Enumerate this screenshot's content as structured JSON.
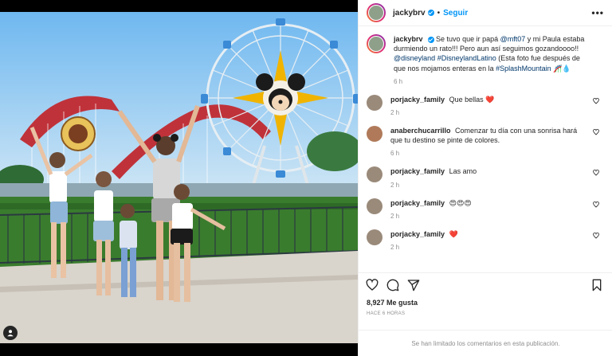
{
  "header": {
    "username": "jackybrv",
    "separator": "•",
    "follow_label": "Seguir",
    "more_label": "•••"
  },
  "caption": {
    "username": "jackybrv",
    "text_a": "Se tuvo que ir papá",
    "mention_1": "@mft07",
    "text_b": "y mi Paula estaba durmiendo un rato!!! Pero aun así seguimos gozandoooo!!",
    "mention_2": "@disneyland",
    "hashtag_1": "#DisneylandLatino",
    "text_c": "(Esta foto fue después de que nos mojamos enteras en la",
    "hashtag_2": "#SplashMountain",
    "emoji": "🎢💧",
    "time": "6 h"
  },
  "comments": [
    {
      "username": "porjacky_family",
      "text": "Que bellas",
      "emoji": "❤️",
      "time": "2 h"
    },
    {
      "username": "anaberchucarrillo",
      "text": "Comenzar tu día con una sonrisa hará que tu destino se pinte de colores.",
      "emoji": "",
      "time": "6 h"
    },
    {
      "username": "porjacky_family",
      "text": "Las amo",
      "emoji": "",
      "time": "2 h"
    },
    {
      "username": "porjacky_family",
      "text": "",
      "emoji": "😍😍😍",
      "time": "2 h"
    },
    {
      "username": "porjacky_family",
      "text": "",
      "emoji": "❤️",
      "time": "2 h"
    }
  ],
  "likes": "8,927 Me gusta",
  "posted_ago": "HACE 6 HORAS",
  "limited_comments": "Se han limitado los comentarios en esta publicación.",
  "colors": {
    "accent": "#0095f6",
    "link": "#00376b",
    "muted": "#8e8e8e",
    "heart": "#ed4956"
  },
  "icons": [
    "heart-icon",
    "comment-icon",
    "share-icon",
    "bookmark-icon",
    "more-icon",
    "user-tag-icon",
    "verified-badge-icon"
  ]
}
